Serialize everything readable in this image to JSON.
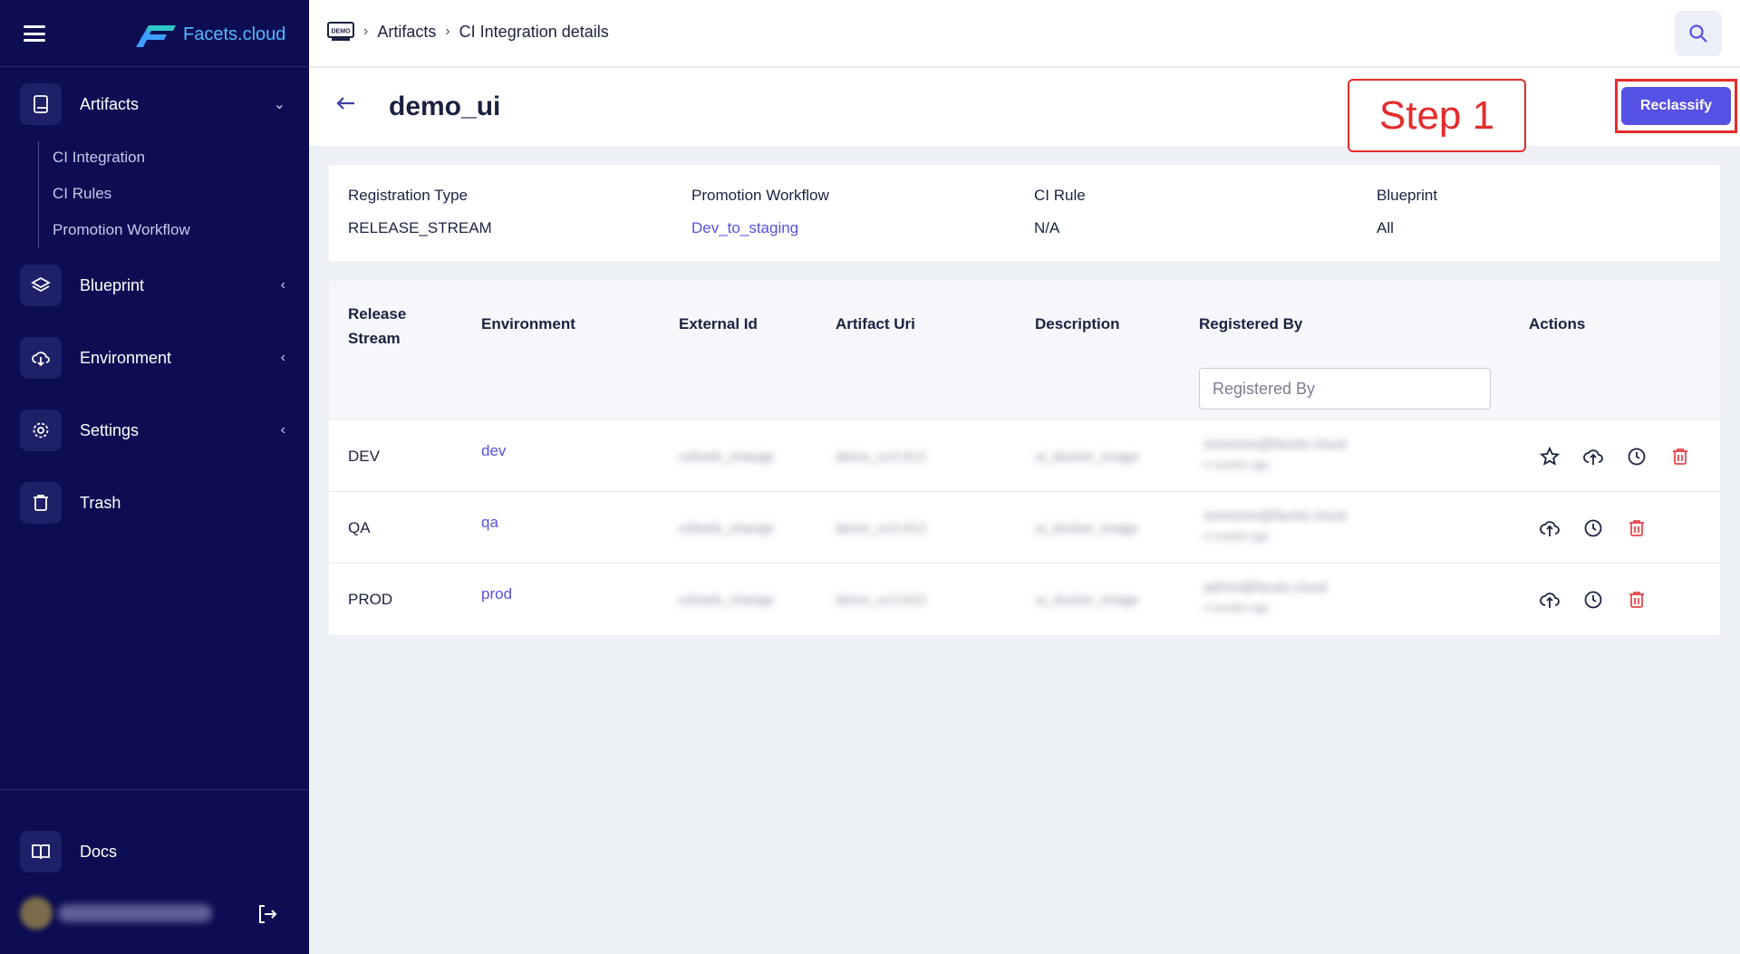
{
  "app": {
    "brand": "Facets.cloud"
  },
  "sidebar": {
    "items": [
      {
        "label": "Artifacts",
        "icon": "book-icon",
        "expanded": true
      },
      {
        "label": "Blueprint",
        "icon": "layers-icon"
      },
      {
        "label": "Environment",
        "icon": "cloud-download-icon"
      },
      {
        "label": "Settings",
        "icon": "gear-icon"
      },
      {
        "label": "Trash",
        "icon": "trash-icon"
      }
    ],
    "sub_items": [
      "CI Integration",
      "CI Rules",
      "Promotion Workflow"
    ],
    "docs_label": "Docs"
  },
  "breadcrumb": {
    "logo_label": "DEMO",
    "items": [
      "Artifacts",
      "CI Integration details"
    ]
  },
  "page": {
    "title": "demo_ui",
    "reclassify_label": "Reclassify",
    "step_label": "Step 1"
  },
  "info": {
    "registration_type": {
      "label": "Registration Type",
      "value": "RELEASE_STREAM"
    },
    "promotion_workflow": {
      "label": "Promotion Workflow",
      "value": "Dev_to_staging"
    },
    "ci_rule": {
      "label": "CI Rule",
      "value": "N/A"
    },
    "blueprint": {
      "label": "Blueprint",
      "value": "All"
    }
  },
  "table": {
    "columns": [
      "Release\nStream",
      "Environment",
      "External Id",
      "Artifact Uri",
      "Description",
      "Registered By",
      "Actions"
    ],
    "filter_placeholder": "Registered By",
    "rows": [
      {
        "stream": "DEV",
        "env": "dev",
        "external_id": "cd/web_change",
        "uri": "demo_ui:0.913",
        "description": "ui_docker_image",
        "registered_by": "someone@facets.cloud",
        "time": "2 months ago"
      },
      {
        "stream": "QA",
        "env": "qa",
        "external_id": "cd/web_change",
        "uri": "demo_ui:0.913",
        "description": "ui_docker_image",
        "registered_by": "someone@facets.cloud",
        "time": "2 months ago"
      },
      {
        "stream": "PROD",
        "env": "prod",
        "external_id": "cd/web_change",
        "uri": "demo_ui:0.913",
        "description": "ui_docker_image",
        "registered_by": "admin@facets.cloud",
        "time": "2 months ago"
      }
    ]
  },
  "colors": {
    "sidebar": "#0c0d52",
    "accent": "#5551e5",
    "danger": "#e5484d",
    "highlight": "#e52b2b"
  }
}
